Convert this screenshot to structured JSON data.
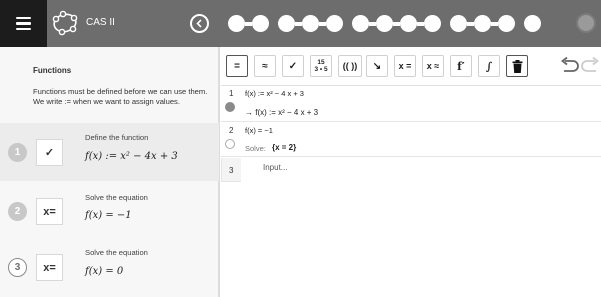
{
  "app": {
    "title": "CAS II"
  },
  "progress": {
    "groups": [
      2,
      3,
      4,
      3,
      1
    ],
    "done_count": 0
  },
  "sidebar": {
    "title": "Functions",
    "intro": "Functions must be defined before we can use them. We write := when we want to assign values.",
    "steps": [
      {
        "num": "1",
        "status": "done",
        "icon": "✓",
        "text": "Define the function",
        "math": "f(x) := x² − 4x + 3"
      },
      {
        "num": "2",
        "status": "done",
        "icon": "x=",
        "text": "Solve the equation",
        "math": "f(x) = −1"
      },
      {
        "num": "3",
        "status": "open",
        "icon": "x=",
        "text": "Solve the equation",
        "math": "f(x) = 0"
      }
    ]
  },
  "toolbar": {
    "buttons": [
      {
        "label": "="
      },
      {
        "label": "≈"
      },
      {
        "label": "✓"
      },
      {
        "label_top": "15",
        "label_bottom": "3 • 5"
      },
      {
        "label": "(( ))"
      },
      {
        "label": "↘"
      },
      {
        "label": "x ="
      },
      {
        "label": "x ≈"
      },
      {
        "label": "f′"
      },
      {
        "label": "∫"
      },
      {
        "label": "🗑"
      }
    ]
  },
  "cas": {
    "rows": [
      {
        "num": "1",
        "input": "f(x) := x² − 4 x + 3",
        "output": "→  f(x) := x² − 4 x + 3"
      },
      {
        "num": "2",
        "input": "f(x) = −1",
        "output_prefix": "Solve:",
        "output": "{x = 2}"
      },
      {
        "num": "3",
        "placeholder": "Input..."
      }
    ]
  },
  "colors": {
    "topbar": "#6d6d6d",
    "accent_dark": "#1c1c1c"
  }
}
